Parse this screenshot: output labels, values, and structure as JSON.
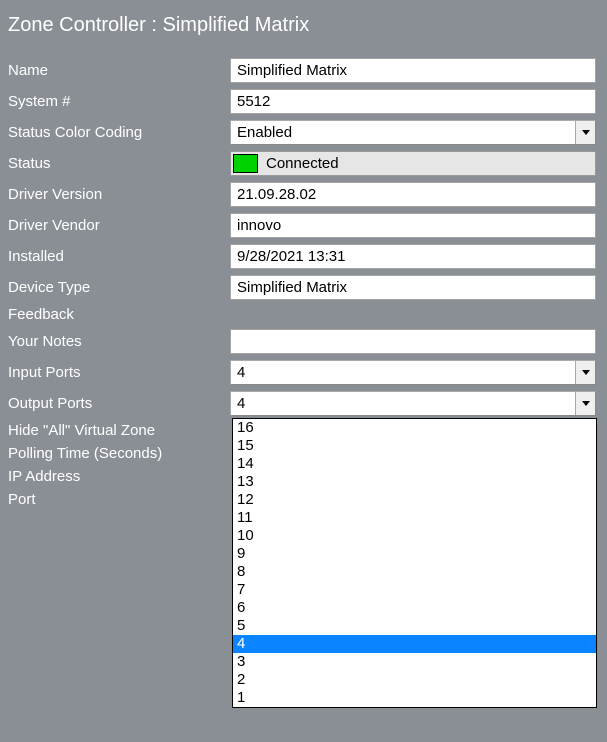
{
  "title": "Zone Controller : Simplified Matrix",
  "fields": {
    "name": {
      "label": "Name",
      "value": "Simplified Matrix"
    },
    "system_num": {
      "label": "System #",
      "value": "5512"
    },
    "status_color_coding": {
      "label": "Status Color Coding",
      "value": "Enabled"
    },
    "status": {
      "label": "Status",
      "value": "Connected",
      "color": "#00d100"
    },
    "driver_version": {
      "label": "Driver Version",
      "value": "21.09.28.02"
    },
    "driver_vendor": {
      "label": "Driver Vendor",
      "value": "innovo"
    },
    "installed": {
      "label": "Installed",
      "value": "9/28/2021 13:31"
    },
    "device_type": {
      "label": "Device Type",
      "value": "Simplified Matrix"
    },
    "feedback": {
      "label": "Feedback",
      "value": ""
    },
    "your_notes": {
      "label": "Your Notes",
      "value": ""
    },
    "input_ports": {
      "label": "Input Ports",
      "value": "4"
    },
    "output_ports": {
      "label": "Output Ports",
      "value": "4",
      "selected": "4",
      "options": [
        "16",
        "15",
        "14",
        "13",
        "12",
        "11",
        "10",
        "9",
        "8",
        "7",
        "6",
        "5",
        "4",
        "3",
        "2",
        "1"
      ]
    },
    "hide_all_virtual_zone": {
      "label": "Hide \"All\" Virtual Zone"
    },
    "polling_time": {
      "label": "Polling Time (Seconds)"
    },
    "ip_address": {
      "label": "IP Address"
    },
    "port": {
      "label": "Port"
    }
  }
}
